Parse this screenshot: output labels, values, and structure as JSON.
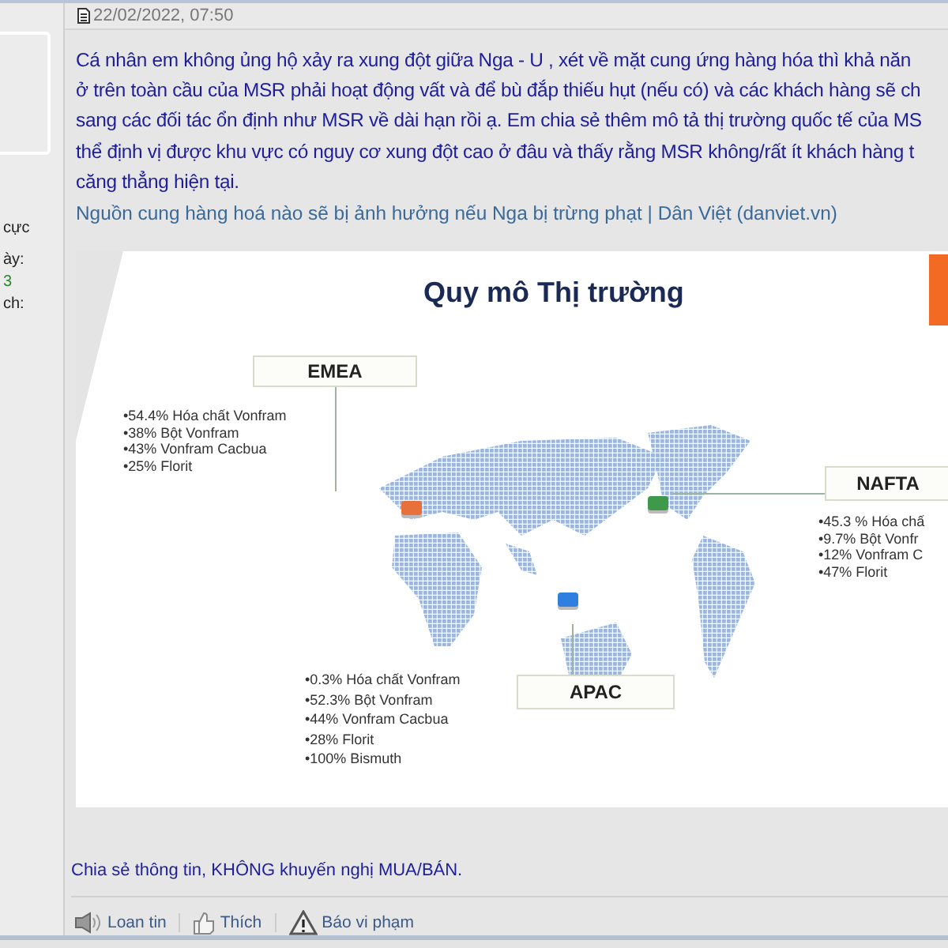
{
  "sidebar": {
    "texts": [
      {
        "text": "cực",
        "kind": "label"
      },
      {
        "text": "ày:",
        "kind": "label"
      },
      {
        "text": "3",
        "kind": "value"
      },
      {
        "text": "ch:",
        "kind": "label"
      }
    ]
  },
  "post": {
    "timestamp": "22/02/2022, 07:50",
    "body_lines": [
      "Cá nhân em không ủng hộ xảy ra xung đột giữa Nga - U , xét về mặt cung ứng hàng hóa thì khả năn",
      "ở trên toàn cầu của MSR phải hoạt động vất và để bù đắp thiếu hụt (nếu có) và các khách hàng sẽ ch",
      "sang các đối tác ổn định như MSR về dài hạn rồi ạ. Em chia sẻ thêm mô tả thị trường quốc tế của MS",
      "thể định vị được khu vực có nguy cơ xung đột cao ở đâu và thấy rằng MSR không/rất ít khách hàng t",
      "căng thẳng hiện tại."
    ],
    "link": "Nguồn cung hàng hoá nào sẽ bị ảnh hưởng nếu Nga bị trừng phạt | Dân Việt (danviet.vn)",
    "slide": {
      "title": "Quy mô Thị trường",
      "regions": [
        {
          "label": "EMEA",
          "color": "#e8703a",
          "items": [
            "•54.4% Hóa chất Vonfram",
            "•38% Bột Vonfram",
            "•43% Vonfram Cacbua",
            "•25% Florit"
          ]
        },
        {
          "label": "NAFTA",
          "color": "#3e9a4a",
          "items": [
            "•45.3 % Hóa chấ",
            "•9.7% Bột Vonfr",
            "•12% Vonfram C",
            "•47% Florit"
          ]
        },
        {
          "label": "APAC",
          "color": "#2f7fe0",
          "items": [
            "•0.3% Hóa chất Vonfram",
            "•52.3% Bột Vonfram",
            "•44% Vonfram Cacbua",
            "•28% Florit",
            "•100% Bismuth"
          ]
        }
      ]
    },
    "signature": "Chia sẻ thông tin, KHÔNG khuyến nghị MUA/BÁN.",
    "actions": [
      {
        "label": "Loan tin",
        "kind": "share"
      },
      {
        "label": "Thích",
        "kind": "like"
      },
      {
        "label": "Báo vi phạm",
        "kind": "report"
      }
    ]
  }
}
